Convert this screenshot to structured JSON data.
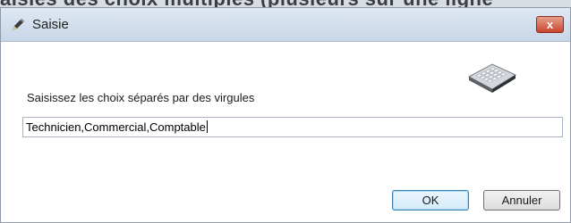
{
  "window": {
    "title": "Saisie",
    "close_label": "x",
    "icons": {
      "app": "pen-icon",
      "decoration": "keyboard-icon"
    }
  },
  "background_strip": {
    "text": "aisies des choix multiples (plusieurs sur une ligne"
  },
  "form": {
    "prompt": "Saisissez les choix séparés par des virgules",
    "input_value": "Technicien,Commercial,Comptable"
  },
  "buttons": {
    "ok_label": "OK",
    "cancel_label": "Annuler"
  },
  "colors": {
    "titlebar": "#c7d6e8",
    "close": "#c8452e",
    "ok_border": "#3c7fb1"
  }
}
